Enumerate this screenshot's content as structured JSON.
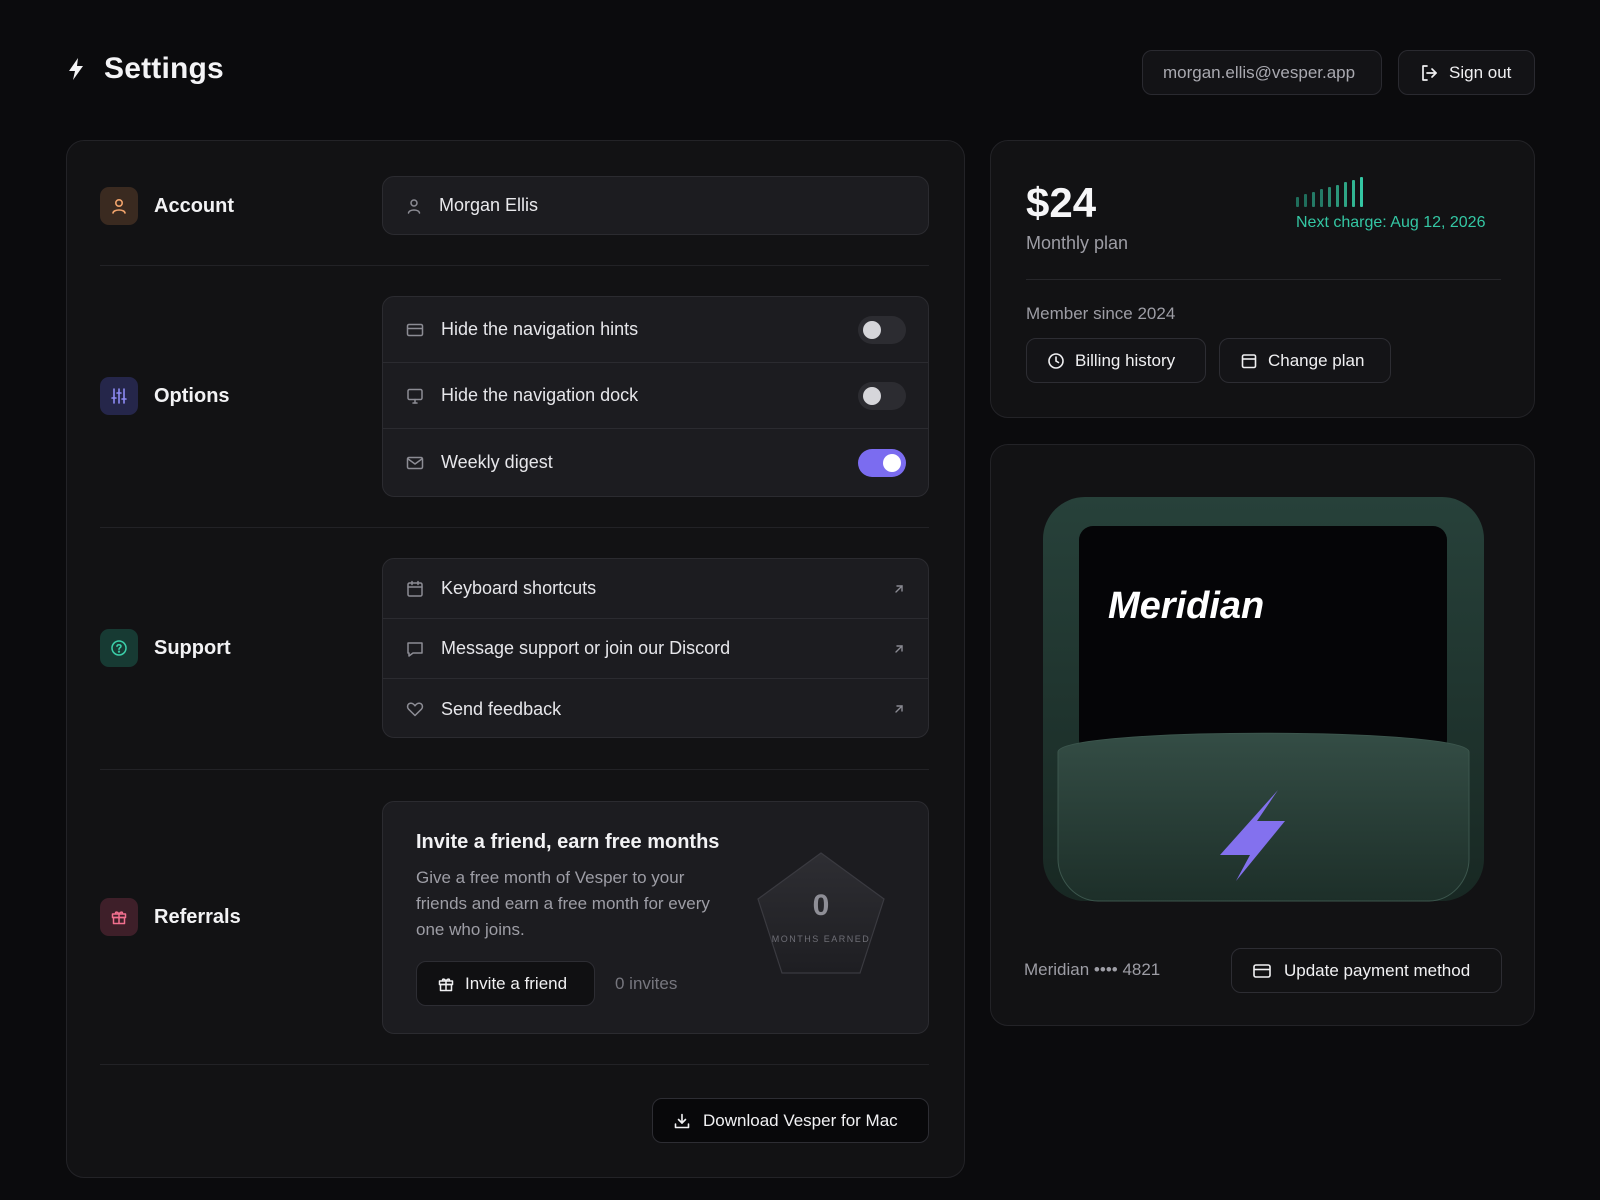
{
  "header": {
    "title": "Settings",
    "email": "morgan.ellis@vesper.app",
    "sign_out": "Sign out"
  },
  "sections": {
    "account": {
      "label": "Account",
      "name_value": "Morgan Ellis"
    },
    "options": {
      "label": "Options",
      "items": [
        {
          "label": "Hide the navigation hints",
          "icon": "credit-card-icon",
          "enabled": false
        },
        {
          "label": "Hide the navigation dock",
          "icon": "monitor-icon",
          "enabled": false
        },
        {
          "label": "Weekly digest",
          "icon": "mail-icon",
          "enabled": true
        }
      ]
    },
    "support": {
      "label": "Support",
      "items": [
        {
          "label": "Keyboard shortcuts",
          "icon": "calendar-icon"
        },
        {
          "label": "Message support or join our Discord",
          "icon": "chat-icon"
        },
        {
          "label": "Send feedback",
          "icon": "heart-icon"
        }
      ]
    },
    "referrals": {
      "label": "Referrals",
      "title": "Invite a friend, earn free months",
      "description": "Give a free month of Vesper to your friends and earn a free month for every one who joins.",
      "invite_button": "Invite a friend",
      "invites_count": "0 invites",
      "badge_value": "0",
      "badge_label": "MONTHS EARNED"
    },
    "download_button": "Download Vesper for Mac"
  },
  "billing": {
    "price": "$24",
    "plan": "Monthly plan",
    "next_charge": "Next charge: Aug 12, 2026",
    "member_since": "Member since 2024",
    "billing_history": "Billing history",
    "change_plan": "Change plan"
  },
  "card": {
    "card_name": "Meridian",
    "card_number": "Meridian •••• 4821",
    "update_payment": "Update payment method"
  },
  "colors": {
    "accent_purple": "#7b6cf0",
    "accent_green": "#34c7a4",
    "background": "#0b0b0d",
    "panel": "#121214"
  }
}
